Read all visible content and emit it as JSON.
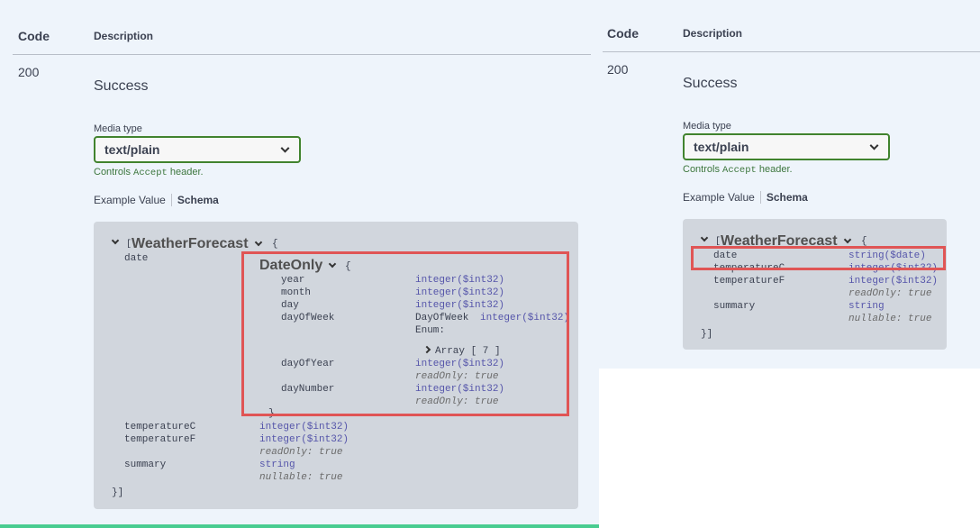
{
  "left": {
    "header": {
      "code": "Code",
      "description": "Description"
    },
    "response": {
      "code": "200",
      "status": "Success"
    },
    "media_type": {
      "label": "Media type",
      "selected": "text/plain",
      "controls_prefix": "Controls",
      "controls_mono": "Accept",
      "controls_suffix": "header."
    },
    "tabs": {
      "example_value": "Example Value",
      "schema": "Schema"
    },
    "schema": {
      "open_bracket": "[",
      "model_name": "WeatherForecast",
      "open_brace": "{",
      "date_field": "date",
      "date_type": "DateOnly",
      "date_brace": "{",
      "fields": [
        {
          "name": "year",
          "type": "integer($int32)"
        },
        {
          "name": "month",
          "type": "integer($int32)"
        },
        {
          "name": "day",
          "type": "integer($int32)"
        },
        {
          "name": "dayOfWeek",
          "type_prefix": "DayOfWeek",
          "type": "integer($int32)",
          "enum_label": "Enum:",
          "array_label": "Array [ 7 ]"
        },
        {
          "name": "dayOfYear",
          "type": "integer($int32)",
          "note": "readOnly: true"
        },
        {
          "name": "dayNumber",
          "type": "integer($int32)",
          "note": "readOnly: true"
        }
      ],
      "date_close": "}",
      "tempC": {
        "name": "temperatureC",
        "type": "integer($int32)"
      },
      "tempF": {
        "name": "temperatureF",
        "type": "integer($int32)",
        "note": "readOnly: true"
      },
      "summary": {
        "name": "summary",
        "type": "string",
        "note": "nullable: true"
      },
      "close": "}]"
    }
  },
  "right": {
    "header": {
      "code": "Code",
      "description": "Description"
    },
    "response": {
      "code": "200",
      "status": "Success"
    },
    "media_type": {
      "label": "Media type",
      "selected": "text/plain",
      "controls_prefix": "Controls",
      "controls_mono": "Accept",
      "controls_suffix": "header."
    },
    "tabs": {
      "example_value": "Example Value",
      "schema": "Schema"
    },
    "schema": {
      "open_bracket": "[",
      "model_name": "WeatherForecast",
      "open_brace": "{",
      "date": {
        "name": "date",
        "type": "string($date)"
      },
      "tempC": {
        "name": "temperatureC",
        "type": "integer($int32)"
      },
      "tempF": {
        "name": "temperatureF",
        "type": "integer($int32)",
        "note": "readOnly: true"
      },
      "summary": {
        "name": "summary",
        "type": "string",
        "note": "nullable: true"
      },
      "close": "}]"
    }
  },
  "colors": {
    "highlight": "#e05555",
    "accent_green": "#41832e",
    "schema_bg": "#d1d6dd",
    "panel_bg": "#eef4fb"
  }
}
